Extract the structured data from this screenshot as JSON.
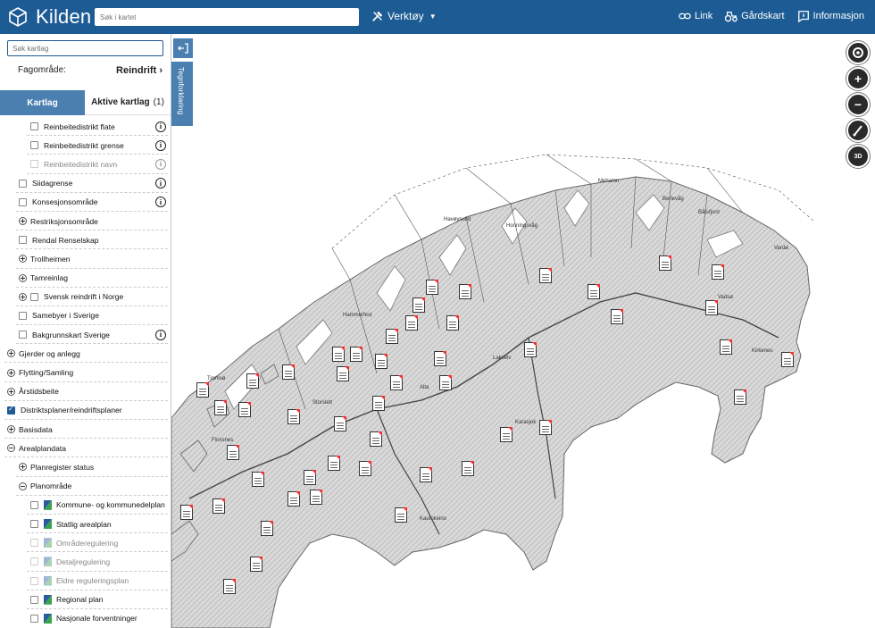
{
  "header": {
    "app_name": "Kilden",
    "search_placeholder": "Søk i kartet",
    "tools_label": "Verktøy",
    "link_label": "Link",
    "farm_map_label": "Gårdskart",
    "info_label": "Informasjon"
  },
  "sidebar": {
    "layer_search_placeholder": "Søk kartlag",
    "fagomrade_label": "Fagområde:",
    "fagomrade_value": "Reindrift",
    "tab_layers": "Kartlag",
    "tab_active": "Aktive kartlag",
    "tab_active_count": "(1)",
    "draw_label": "Tegnforklaring",
    "items": [
      {
        "label": "Reinbeitedistrikt flate"
      },
      {
        "label": "Reinbeitedistrikt grense"
      },
      {
        "label": "Reinbeitedistrikt navn"
      },
      {
        "label": "Siidagrense"
      },
      {
        "label": "Konsesjonsområde"
      },
      {
        "label": "Restriksjonsområde"
      },
      {
        "label": "Rendal Renselskap"
      },
      {
        "label": "Trollheimen"
      },
      {
        "label": "Tamreinlag"
      },
      {
        "label": "Svensk reindrift i Norge"
      },
      {
        "label": "Samebyer i Sverige"
      },
      {
        "label": "Bakgrunnskart Sverige"
      },
      {
        "label": "Gjerder og anlegg"
      },
      {
        "label": "Flytting/Samling"
      },
      {
        "label": "Årstidsbeite"
      },
      {
        "label": "Distriktsplaner/reindriftsplaner"
      },
      {
        "label": "Basisdata"
      },
      {
        "label": "Arealplandata"
      },
      {
        "label": "Planregister status"
      },
      {
        "label": "Planområde"
      },
      {
        "label": "Kommune- og kommunedelplan"
      },
      {
        "label": "Statlig arealplan"
      },
      {
        "label": "Områderegulering"
      },
      {
        "label": "Detaljregulering"
      },
      {
        "label": "Eldre reguleringsplan"
      },
      {
        "label": "Regional plan"
      },
      {
        "label": "Nasjonale forventninger"
      }
    ]
  },
  "map": {
    "controls": {
      "zoom_in": "+",
      "zoom_out": "−",
      "view_3d": "3D"
    },
    "places": [
      "Havøysund",
      "Honningsvåg",
      "Mehamn",
      "Berlevåg",
      "Båtsfjord",
      "Vardø",
      "Vadsø",
      "Kirkenes",
      "Hammerfest",
      "Alta",
      "Lakselv",
      "Karasjok",
      "Kautokeino",
      "Tromsø",
      "Finnsnes",
      "Storslett"
    ]
  }
}
